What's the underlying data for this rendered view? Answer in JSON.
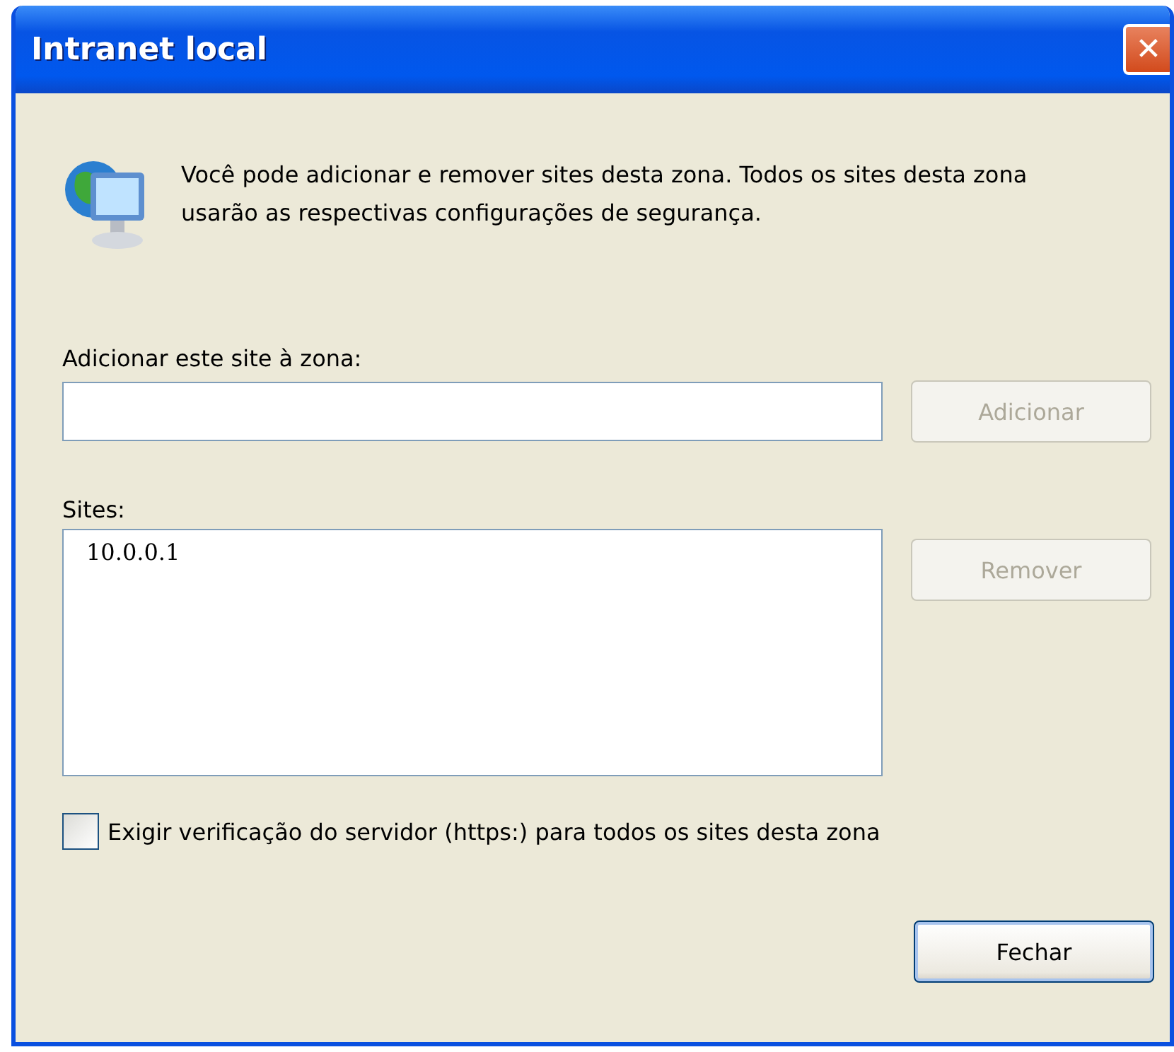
{
  "window": {
    "title": "Intranet local",
    "close": "✕"
  },
  "intro": "Você pode adicionar e remover sites desta zona. Todos os sites desta zona usarão as respectivas configurações de segurança.",
  "add_field": {
    "label": "Adicionar este site à zona:"
  },
  "add_button": {
    "label": "Adicionar",
    "disabled": true
  },
  "sites": {
    "label": "Sites:",
    "items": [
      {
        "text": "10.0.0.1",
        "selected": false
      }
    ]
  },
  "remove_button": {
    "label": "Remover",
    "disabled": true
  },
  "https_check": {
    "label": "Exigir verificação do servidor (https:) para todos os sites desta zona",
    "checked": false
  },
  "close_button": {
    "label": "Fechar",
    "disabled": false
  }
}
